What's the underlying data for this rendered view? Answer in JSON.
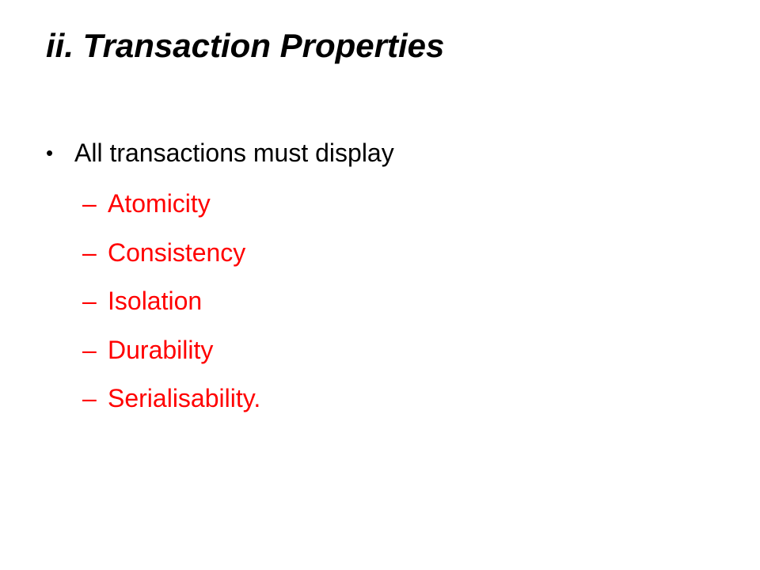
{
  "slide": {
    "title": "ii. Transaction Properties",
    "bullet": {
      "marker": "•",
      "text": "All transactions must display"
    },
    "sub_items": [
      {
        "dash": "–",
        "label": "Atomicity"
      },
      {
        "dash": "–",
        "label": "Consistency"
      },
      {
        "dash": "–",
        "label": "Isolation"
      },
      {
        "dash": "–",
        "label": "Durability"
      },
      {
        "dash": "–",
        "label": "Serialisability."
      }
    ],
    "colors": {
      "title": "#000000",
      "bullet_text": "#000000",
      "sub_item_text": "#ff0000",
      "background": "#ffffff"
    }
  }
}
